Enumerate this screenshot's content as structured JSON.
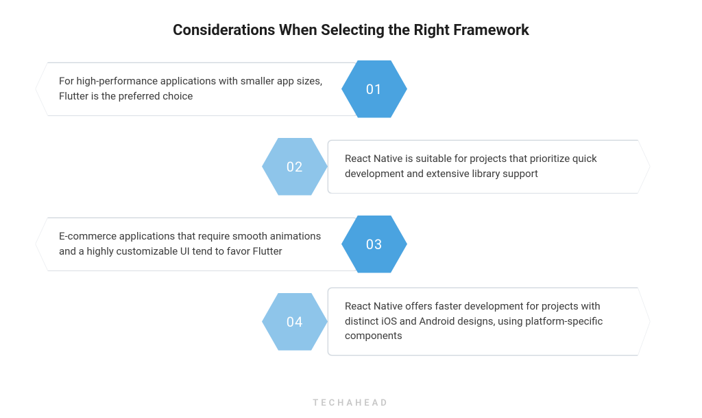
{
  "title": "Considerations When Selecting the Right Framework",
  "items": [
    {
      "number": "01",
      "text": "For high-performance applications with smaller app sizes, Flutter is the preferred choice",
      "side": "left",
      "hexShade": "dark"
    },
    {
      "number": "02",
      "text": "React Native is suitable for projects that prioritize quick development and extensive library support",
      "side": "right",
      "hexShade": "light"
    },
    {
      "number": "03",
      "text": "E-commerce applications that require smooth animations and a highly customizable UI tend to favor Flutter",
      "side": "left",
      "hexShade": "dark"
    },
    {
      "number": "04",
      "text": "React Native offers faster development for projects with distinct iOS and Android designs, using platform-specific components",
      "side": "right",
      "hexShade": "light"
    }
  ],
  "brand": "TECHAHEAD",
  "colors": {
    "hexDark": "#4aa3e0",
    "hexLight": "#8ec5ea",
    "border": "#d0d7de",
    "text": "#3c3c3c"
  }
}
